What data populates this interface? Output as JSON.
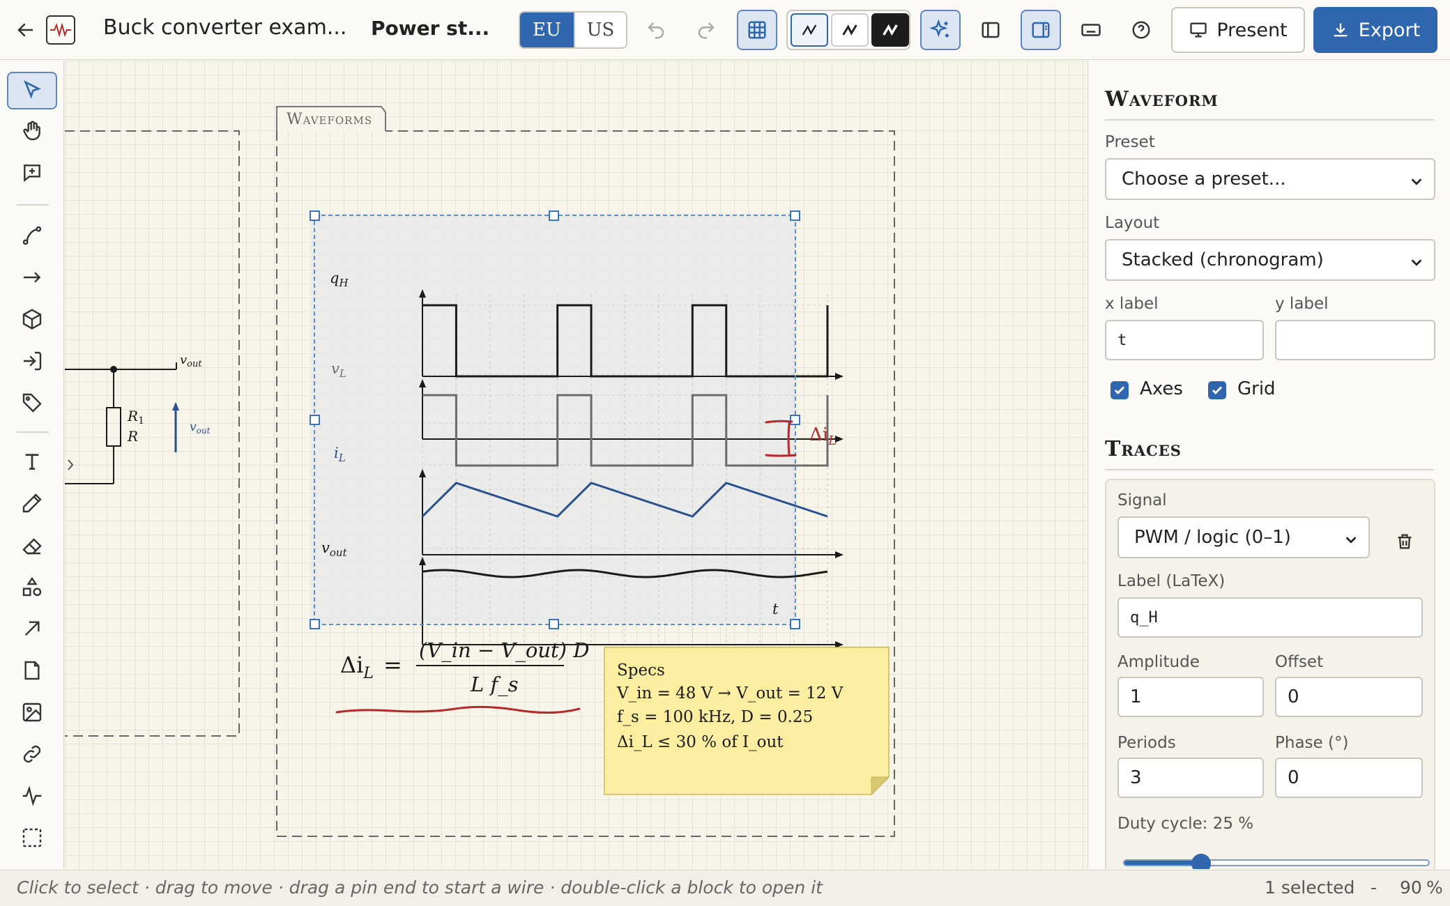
{
  "topbar": {
    "document_title": "Buck converter exam...",
    "page_title": "Power st...",
    "standard_toggle": {
      "options": [
        "EU",
        "US"
      ],
      "selected": "EU"
    },
    "present_label": "Present",
    "export_label": "Export"
  },
  "canvas": {
    "frame_title": "Waveforms",
    "circuit": {
      "node_label": "v_out",
      "resistor_label_1": "R₁",
      "resistor_label_2": "R",
      "arrow_label": "v_out"
    },
    "chronogram": {
      "traces": [
        {
          "label_main": "q",
          "label_sub": "H",
          "signal": "PWM / logic (0–1)",
          "duty_cycle": 0.25,
          "periods": 3
        },
        {
          "label_main": "v",
          "label_sub": "L",
          "signal": "PWM (inverted)",
          "duty_cycle": 0.25,
          "periods": 3
        },
        {
          "label_main": "i",
          "label_sub": "L",
          "signal": "triangle ripple",
          "duty_cycle": 0.25,
          "periods": 3
        },
        {
          "label_main": "v",
          "label_sub": "out",
          "signal": "sine ripple",
          "periods": 3
        }
      ],
      "x_label": "t",
      "annotation": {
        "symbol": "Δi",
        "sub": "L"
      }
    },
    "formula": {
      "lhs": "Δi",
      "lhs_sub": "L",
      "numerator": "(V_in − V_out) D",
      "denominator": "L f_s"
    },
    "sticky_note": {
      "title": "Specs",
      "lines": [
        "V_in = 48 V → V_out = 12 V",
        "f_s = 100 kHz, D = 0.25",
        "Δi_L ≤ 30 % of I_out"
      ]
    }
  },
  "panel": {
    "waveform_title": "Waveform",
    "preset_label": "Preset",
    "preset_value": "Choose a preset...",
    "layout_label": "Layout",
    "layout_value": "Stacked (chronogram)",
    "xlabel_label": "x label",
    "xlabel_value": "t",
    "ylabel_label": "y label",
    "ylabel_value": "",
    "axes_label": "Axes",
    "axes_checked": true,
    "grid_label": "Grid",
    "grid_checked": true,
    "traces_title": "Traces",
    "signal_label": "Signal",
    "signal_value": "PWM / logic (0–1)",
    "latex_label": "Label (LaTeX)",
    "latex_value": "q_H",
    "amplitude_label": "Amplitude",
    "amplitude_value": "1",
    "offset_label": "Offset",
    "offset_value": "0",
    "periods_label": "Periods",
    "periods_value": "3",
    "phase_label": "Phase (°)",
    "phase_value": "0",
    "duty_label": "Duty cycle: 25 %",
    "duty_value": 0.25
  },
  "statusbar": {
    "hint": "Click to select · drag to move · drag a pin end to start a wire · double-click a block to open it",
    "selection": "1 selected",
    "zoom_minus": "-",
    "zoom_value": "90",
    "zoom_unit": "%"
  },
  "colors": {
    "accent": "#2f66ad",
    "trace_black": "#1a1a1a",
    "trace_gray": "#6b6b6b",
    "trace_blue": "#27518f",
    "annotation_red": "#b52a2a",
    "sticky_yellow": "#fbeea0"
  }
}
